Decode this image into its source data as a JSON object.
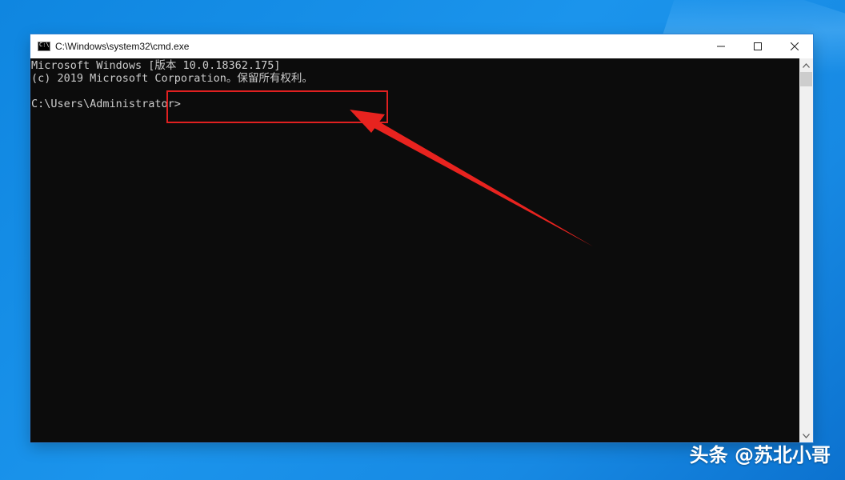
{
  "window": {
    "title": "C:\\Windows\\system32\\cmd.exe",
    "icon": "cmd-icon",
    "caption_buttons": [
      {
        "name": "minimize",
        "glyph": "─"
      },
      {
        "name": "maximize",
        "glyph": "☐"
      },
      {
        "name": "close",
        "glyph": "✕"
      }
    ]
  },
  "console": {
    "lines": [
      "Microsoft Windows [版本 10.0.18362.175]",
      "(c) 2019 Microsoft Corporation。保留所有权利。",
      "",
      "C:\\Users\\Administrator>"
    ],
    "background_color": "#0c0c0c",
    "text_color": "#cccccc"
  },
  "annotation": {
    "color": "#e02020"
  },
  "watermark": {
    "text": "头条 @苏北小哥"
  }
}
